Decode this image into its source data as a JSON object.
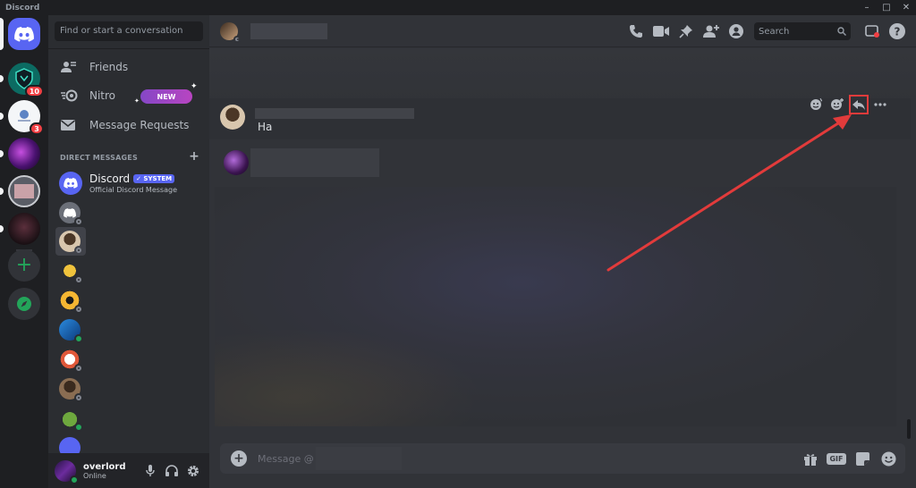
{
  "window": {
    "title": "Discord",
    "controls": [
      "–",
      "□",
      "✕"
    ]
  },
  "servers": [
    {
      "name": "home",
      "badge": ""
    },
    {
      "name": "server-shield",
      "badge": "10"
    },
    {
      "name": "server-blue",
      "badge": "3"
    },
    {
      "name": "server-purple",
      "badge": ""
    },
    {
      "name": "server-pink",
      "badge": ""
    },
    {
      "name": "server-dark",
      "badge": ""
    }
  ],
  "sidebar": {
    "search_placeholder": "Find or start a conversation",
    "nav": [
      {
        "label": "Friends",
        "icon": "friends-icon"
      },
      {
        "label": "Nitro",
        "icon": "nitro-icon",
        "badge": "NEW"
      },
      {
        "label": "Message Requests",
        "icon": "envelope-icon"
      }
    ],
    "dm_header": "DIRECT MESSAGES",
    "dm_add": "+",
    "discord_dm": {
      "name": "Discord",
      "tag": "✓ SYSTEM",
      "subtitle": "Official Discord Message"
    }
  },
  "user": {
    "name": "overlord",
    "status": "Online"
  },
  "header": {
    "search_placeholder": "Search"
  },
  "messages": [
    {
      "text": "Ha"
    }
  ],
  "composer": {
    "placeholder": "Message @",
    "gif": "GIF"
  },
  "colors": {
    "blurple": "#5865f2",
    "highlight": "#e23b3b",
    "online": "#23a55a",
    "badge": "#f23f43"
  }
}
